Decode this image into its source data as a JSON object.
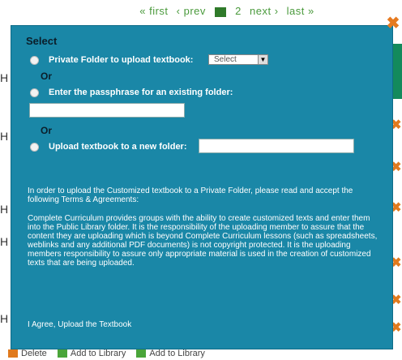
{
  "pager": {
    "first": "« first",
    "prev": "‹ prev",
    "current": "1",
    "page2": "2",
    "next": "next ›",
    "last": "last »"
  },
  "modal": {
    "title": "Select",
    "close_icon": "close-icon",
    "option1_label": "Private Folder to upload textbook:",
    "select_value": "Select",
    "or1": "Or",
    "option2_label": "Enter the passphrase for an existing folder:",
    "passphrase_value": "",
    "or2": "Or",
    "option3_label": "Upload textbook to a new folder:",
    "newfolder_value": "",
    "intro": "In order to upload the Customized textbook to a Private Folder, please read and accept the following Terms & Agreements:",
    "terms_body": "Complete Curriculum provides groups with the ability to create customized texts and enter them into the Public Library folder. It is the responsibility of the uploading member to assure that the content they are uploading which is beyond Complete Curriculum lessons (such as spreadsheets, weblinks and any additional PDF documents) is not copyright protected. It is the uploading members responsibility to assure only appropriate material is used in the creation of customized texts that are being uploaded.",
    "agree_link": "I Agree, Upload the Textbook"
  },
  "background": {
    "row_letter": "H",
    "bottom_items": [
      "Delete",
      "Add to Library",
      "Add to Library"
    ]
  },
  "colors": {
    "modal_bg": "#1a87a7",
    "close_orange": "#e67a1f",
    "accent_green": "#2f7a2a"
  }
}
